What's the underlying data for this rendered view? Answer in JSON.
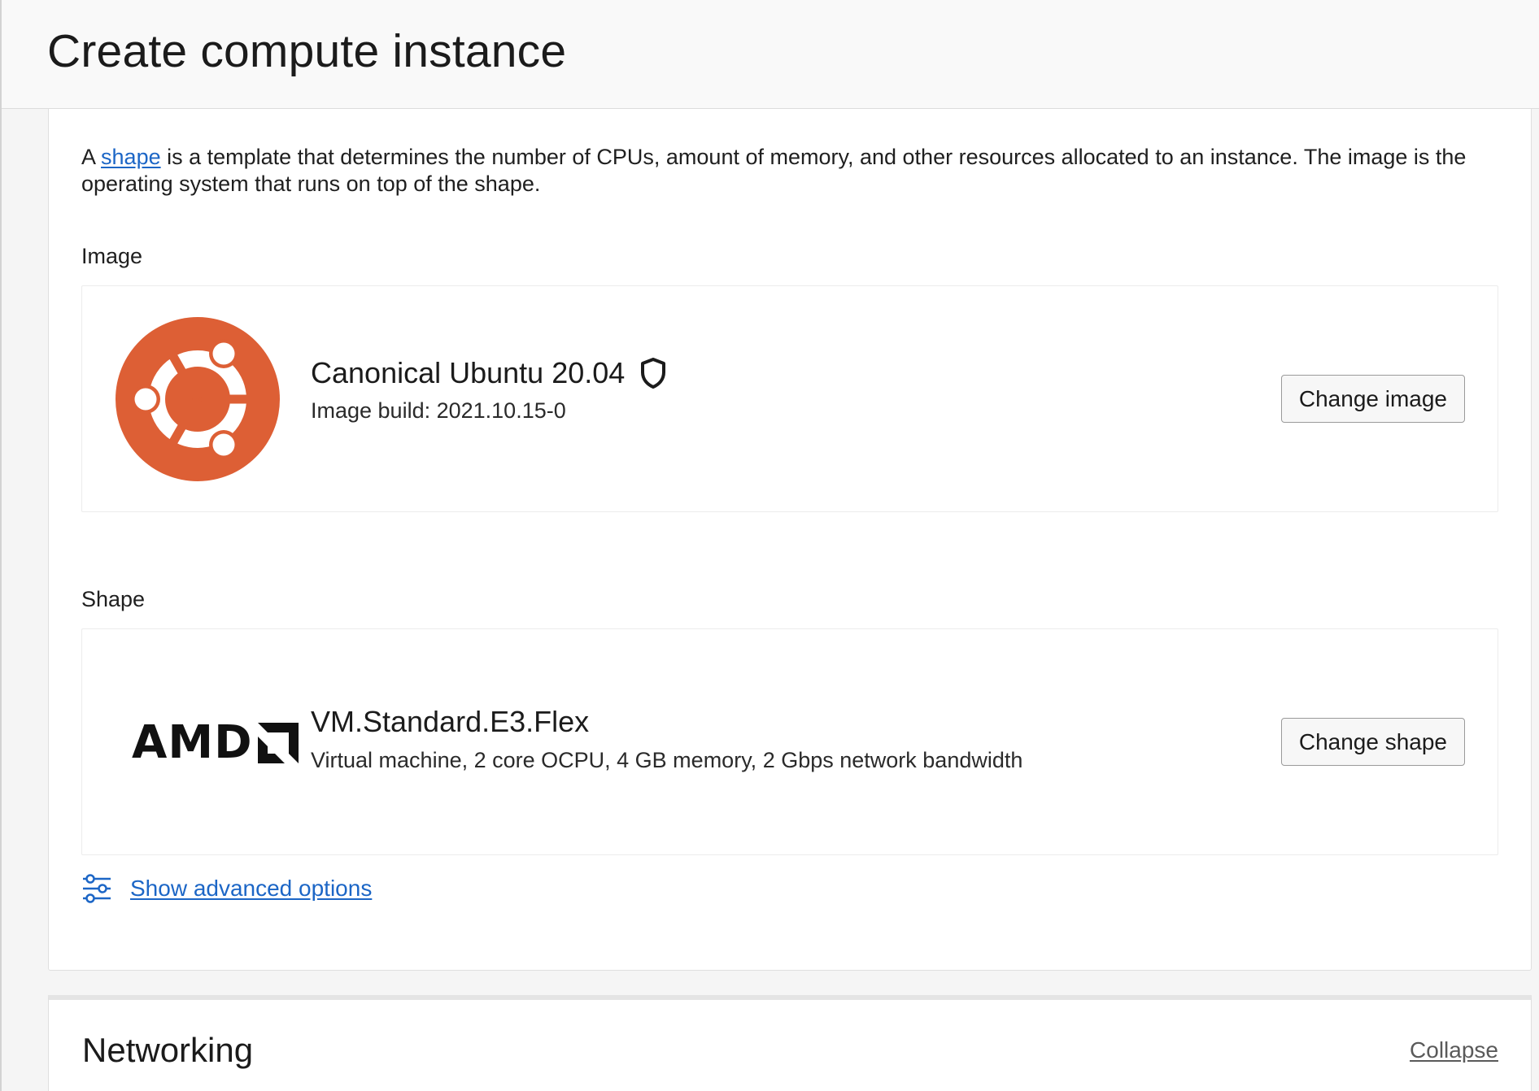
{
  "header": {
    "title": "Create compute instance"
  },
  "intro": {
    "prefix": "A ",
    "link": "shape",
    "suffix": " is a template that determines the number of CPUs, amount of memory, and other resources allocated to an instance. The image is the operating system that runs on top of the shape."
  },
  "image_section": {
    "label": "Image",
    "name": "Canonical Ubuntu 20.04",
    "build": "Image build: 2021.10.15-0",
    "button": "Change image",
    "logo_icon": "ubuntu-logo",
    "badge_icon": "shield-icon",
    "logo_color": "#dd5f35"
  },
  "shape_section": {
    "label": "Shape",
    "name": "VM.Standard.E3.Flex",
    "description": "Virtual machine, 2 core OCPU, 4 GB memory, 2 Gbps network bandwidth",
    "button": "Change shape",
    "logo_text": "AMD",
    "logo_icon": "amd-logo"
  },
  "advanced": {
    "label": "Show advanced options",
    "icon": "sliders-icon"
  },
  "networking": {
    "title": "Networking",
    "collapse": "Collapse"
  },
  "colors": {
    "link": "#1c66c6",
    "background": "#f5f5f5"
  }
}
